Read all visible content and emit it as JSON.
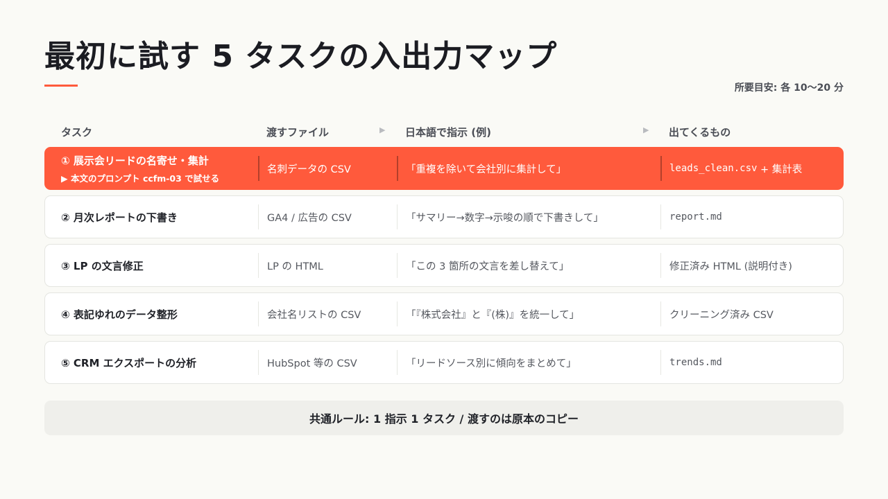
{
  "title": "最初に試す 5 タスクの入出力マップ",
  "time_note": "所要目安: 各 10〜20 分",
  "headers": {
    "task": "タスク",
    "file": "渡すファイル",
    "instruction": "日本語で指示 (例)",
    "output": "出てくるもの"
  },
  "rows": [
    {
      "task": "① 展示会リードの名寄せ・集計",
      "sub": "▶ 本文のプロンプト ccfm-03 で試せる",
      "file": "名刺データの CSV",
      "instruction": "「重複を除いて会社別に集計して」",
      "output_code": "leads_clean.csv",
      "output_rest": " + 集計表",
      "highlighted": true
    },
    {
      "task": "② 月次レポートの下書き",
      "file": "GA4 / 広告の CSV",
      "instruction": "「サマリー→数字→示唆の順で下書きして」",
      "output_code": "report.md"
    },
    {
      "task": "③ LP の文言修正",
      "file": "LP の HTML",
      "instruction": "「この 3 箇所の文言を差し替えて」",
      "output": "修正済み HTML (説明付き)"
    },
    {
      "task": "④ 表記ゆれのデータ整形",
      "file": "会社名リストの CSV",
      "instruction": "「『株式会社』と『(株)』を統一して」",
      "output": "クリーニング済み CSV"
    },
    {
      "task": "⑤ CRM エクスポートの分析",
      "file": "HubSpot 等の CSV",
      "instruction": "「リードソース別に傾向をまとめて」",
      "output_code": "trends.md"
    }
  ],
  "footer": "共通ルール: 1 指示 1 タスク / 渡すのは原本のコピー",
  "colors": {
    "accent": "#ff5a3c",
    "background": "#fafaf6",
    "footer_bg": "#efefeb",
    "text": "#1f2127"
  }
}
